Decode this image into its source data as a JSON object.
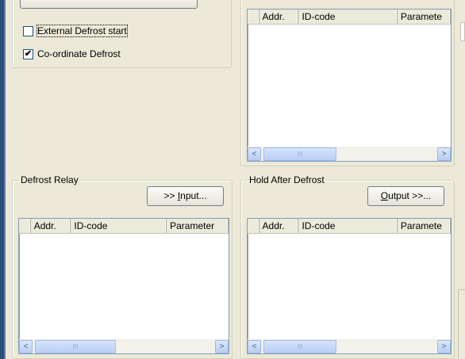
{
  "checkboxes": [
    {
      "label": "External Defrost start",
      "checked": false,
      "check_glyph": ""
    },
    {
      "label": "Co-ordinate Defrost",
      "checked": true,
      "check_glyph": "✔"
    }
  ],
  "columns": {
    "addr": "Addr.",
    "id_code": "ID-code",
    "param_truncated": "Paramete",
    "param": "Parameter"
  },
  "groups": {
    "defrost_relay": {
      "title": "Defrost Relay",
      "button_pre": ">> ",
      "button_ul": "I",
      "button_post": "nput..."
    },
    "hold_after_defrost": {
      "title": "Hold After Defrost",
      "button_pre": "",
      "button_ul": "O",
      "button_post": "utput >>..."
    }
  },
  "scrollbar": {
    "left_arrow": "<",
    "right_arrow": ">",
    "thumb_grip": "III"
  }
}
